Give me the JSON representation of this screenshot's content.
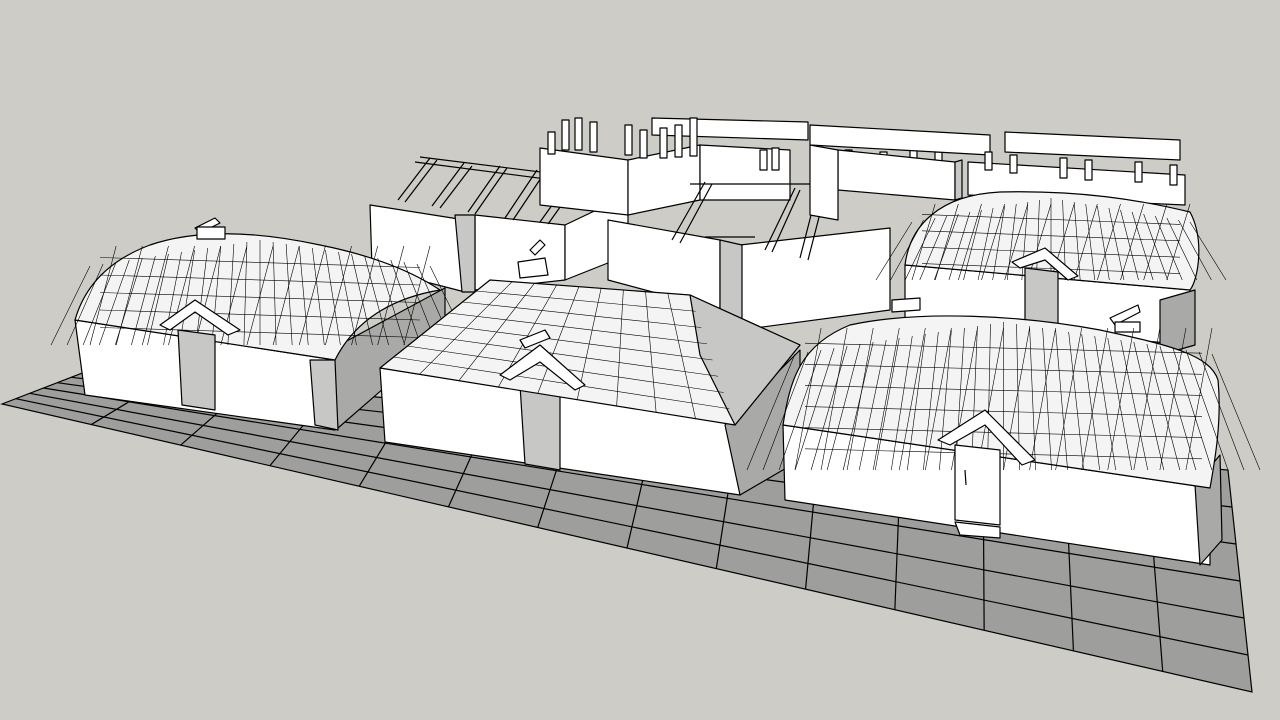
{
  "viewport": {
    "background_color": "#cdccc6",
    "ground_color": "#9e9e9c",
    "wall_color": "#ffffff",
    "shade_color": "#a9a9a7",
    "edge_color": "#000000"
  },
  "scene": {
    "model_icon": "village-model-icon",
    "ground_icon": "grid-ground-icon",
    "buildings": [
      {
        "id": "dome-house-left",
        "roof": "dome"
      },
      {
        "id": "hip-roof-house-center",
        "roof": "hip"
      },
      {
        "id": "dome-house-right-front",
        "roof": "dome"
      },
      {
        "id": "dome-house-right-back",
        "roof": "dome"
      },
      {
        "id": "roofless-frame-back-left",
        "roof": "rafters"
      },
      {
        "id": "roofless-frame-back-center",
        "roof": "rafters"
      },
      {
        "id": "open-wall-back-right",
        "roof": "none"
      },
      {
        "id": "open-wall-back-far-right",
        "roof": "none"
      }
    ]
  }
}
